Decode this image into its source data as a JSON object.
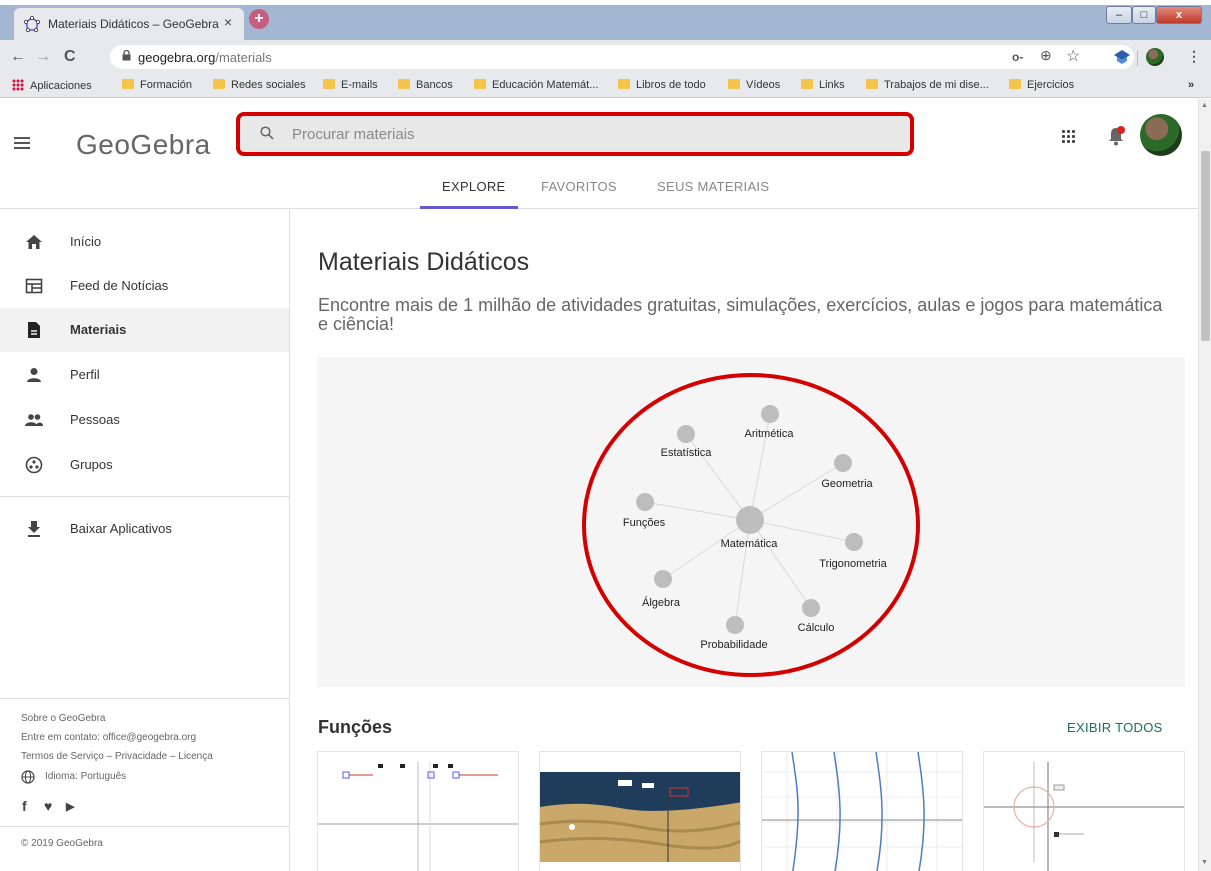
{
  "browser": {
    "tab_title": "Materiais Didáticos – GeoGebra",
    "tab_close": "×",
    "new_tab": "+",
    "url_domain": "geogebra.org",
    "url_path": "/materials",
    "back": "←",
    "forward": "→",
    "reload": "C",
    "key_icon": "o-",
    "zoom_icon": "⊕",
    "star_icon": "☆",
    "bookmarks": [
      {
        "label": "Aplicaciones",
        "icon": "apps-grid"
      },
      {
        "label": "Formación",
        "icon": "folder"
      },
      {
        "label": "Redes sociales",
        "icon": "folder"
      },
      {
        "label": "E-mails",
        "icon": "folder"
      },
      {
        "label": "Bancos",
        "icon": "folder"
      },
      {
        "label": "Educación Matemát...",
        "icon": "folder"
      },
      {
        "label": "Libros de todo",
        "icon": "folder"
      },
      {
        "label": "Vídeos",
        "icon": "folder"
      },
      {
        "label": "Links",
        "icon": "folder"
      },
      {
        "label": "Trabajos de mi dise...",
        "icon": "folder"
      },
      {
        "label": "Ejercicios",
        "icon": "folder"
      }
    ],
    "bookmarks_more": "»"
  },
  "header": {
    "logo": "GeoGebra",
    "search_placeholder": "Procurar materiais",
    "tabs": [
      {
        "label": "EXPLORE",
        "active": true
      },
      {
        "label": "FAVORITOS",
        "active": false
      },
      {
        "label": "SEUS MATERIAIS",
        "active": false
      }
    ],
    "search_highlight_color": "#d40000"
  },
  "sidebar": {
    "items": [
      {
        "label": "Início",
        "icon": "home-icon"
      },
      {
        "label": "Feed de Notícias",
        "icon": "news-feed-icon"
      },
      {
        "label": "Materiais",
        "icon": "document-icon",
        "active": true
      },
      {
        "label": "Perfil",
        "icon": "person-icon"
      },
      {
        "label": "Pessoas",
        "icon": "people-icon"
      },
      {
        "label": "Grupos",
        "icon": "groups-icon"
      }
    ],
    "download": {
      "label": "Baixar Aplicativos",
      "icon": "download-icon"
    },
    "footer": {
      "about": "Sobre o GeoGebra",
      "contact": "Entre em contato: office@geogebra.org",
      "terms": "Termos de Serviço – Privacidade – Licença",
      "language": "Idioma: Português",
      "copyright": "© 2019 GeoGebra",
      "social": [
        "facebook-icon",
        "twitter-icon",
        "youtube-icon"
      ]
    }
  },
  "main": {
    "title": "Materiais Didáticos",
    "subtitle": "Encontre mais de 1 milhão de atividades gratuitas, simulações, exercícios, aulas e jogos para matemática e ciência!",
    "topic_graph": {
      "center": "Matemática",
      "topics": [
        "Aritmética",
        "Estatística",
        "Geometria",
        "Funções",
        "Trigonometria",
        "Álgebra",
        "Cálculo",
        "Probabilidade"
      ],
      "highlight_color": "#d40000"
    },
    "section_title": "Funções",
    "see_all": "EXIBIR TODOS"
  }
}
